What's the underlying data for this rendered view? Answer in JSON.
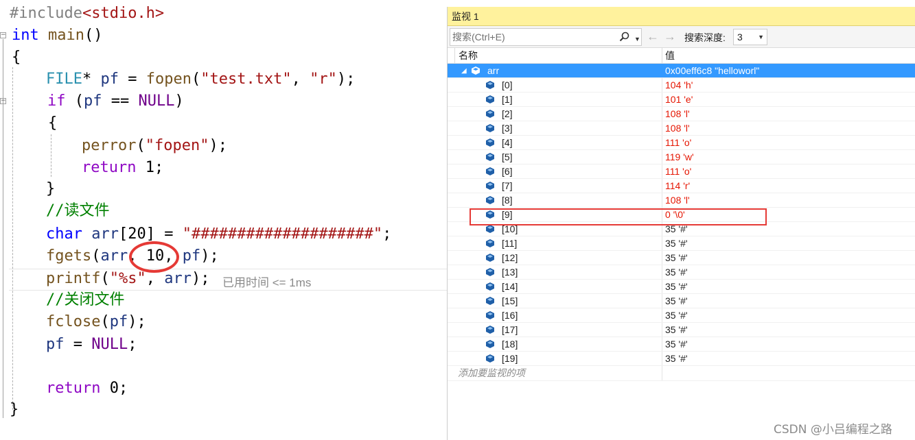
{
  "editor": {
    "lines": {
      "include_directive": "#include",
      "include_header": "<stdio.h>",
      "main_type": "int",
      "main_name": "main",
      "main_parens": "()",
      "open_brace": "{",
      "file_type": "FILE",
      "star": "*",
      "pf_var": "pf",
      "assign": " = ",
      "fopen_fn": "fopen",
      "fopen_arg1": "\"test.txt\"",
      "fopen_arg2": "\"r\"",
      "if_kw": "if",
      "null_macro": "NULL",
      "eqeq": " == ",
      "perror_fn": "perror",
      "perror_arg": "\"fopen\"",
      "return_kw": "return",
      "return_one": " 1;",
      "close_brace": "}",
      "comment_read": "//读文件",
      "char_kw": "char",
      "arr_var": "arr",
      "arr_size": "[20]",
      "arr_init": "\"####################\"",
      "fgets_fn": "fgets",
      "fgets_n": "10",
      "printf_fn": "printf",
      "printf_fmt": "\"%s\"",
      "comment_close": "//关闭文件",
      "fclose_fn": "fclose",
      "return_zero": " 0;"
    },
    "perf_tip": "已用时间 <= 1ms"
  },
  "watch": {
    "title": "监视 1",
    "search_placeholder": "搜索(Ctrl+E)",
    "depth_label": "搜索深度:",
    "depth_value": "3",
    "col_name": "名称",
    "col_value": "值",
    "root": {
      "name": "arr",
      "value": "0x00eff6c8 \"helloworl\""
    },
    "items": [
      {
        "name": "[0]",
        "value": "104 'h'"
      },
      {
        "name": "[1]",
        "value": "101 'e'"
      },
      {
        "name": "[2]",
        "value": "108 'l'"
      },
      {
        "name": "[3]",
        "value": "108 'l'"
      },
      {
        "name": "[4]",
        "value": "111 'o'"
      },
      {
        "name": "[5]",
        "value": "119 'w'"
      },
      {
        "name": "[6]",
        "value": "111 'o'"
      },
      {
        "name": "[7]",
        "value": "114 'r'"
      },
      {
        "name": "[8]",
        "value": "108 'l'"
      },
      {
        "name": "[9]",
        "value": "0 '\\0'"
      },
      {
        "name": "[10]",
        "value": "35 '#'"
      },
      {
        "name": "[11]",
        "value": "35 '#'"
      },
      {
        "name": "[12]",
        "value": "35 '#'"
      },
      {
        "name": "[13]",
        "value": "35 '#'"
      },
      {
        "name": "[14]",
        "value": "35 '#'"
      },
      {
        "name": "[15]",
        "value": "35 '#'"
      },
      {
        "name": "[16]",
        "value": "35 '#'"
      },
      {
        "name": "[17]",
        "value": "35 '#'"
      },
      {
        "name": "[18]",
        "value": "35 '#'"
      },
      {
        "name": "[19]",
        "value": "35 '#'"
      }
    ],
    "add_watch": "添加要监视的项",
    "colors": {
      "changed": "#e51400",
      "selected": "#3399ff",
      "title_bg": "#fff29d"
    }
  },
  "watermark": "CSDN @小吕编程之路"
}
